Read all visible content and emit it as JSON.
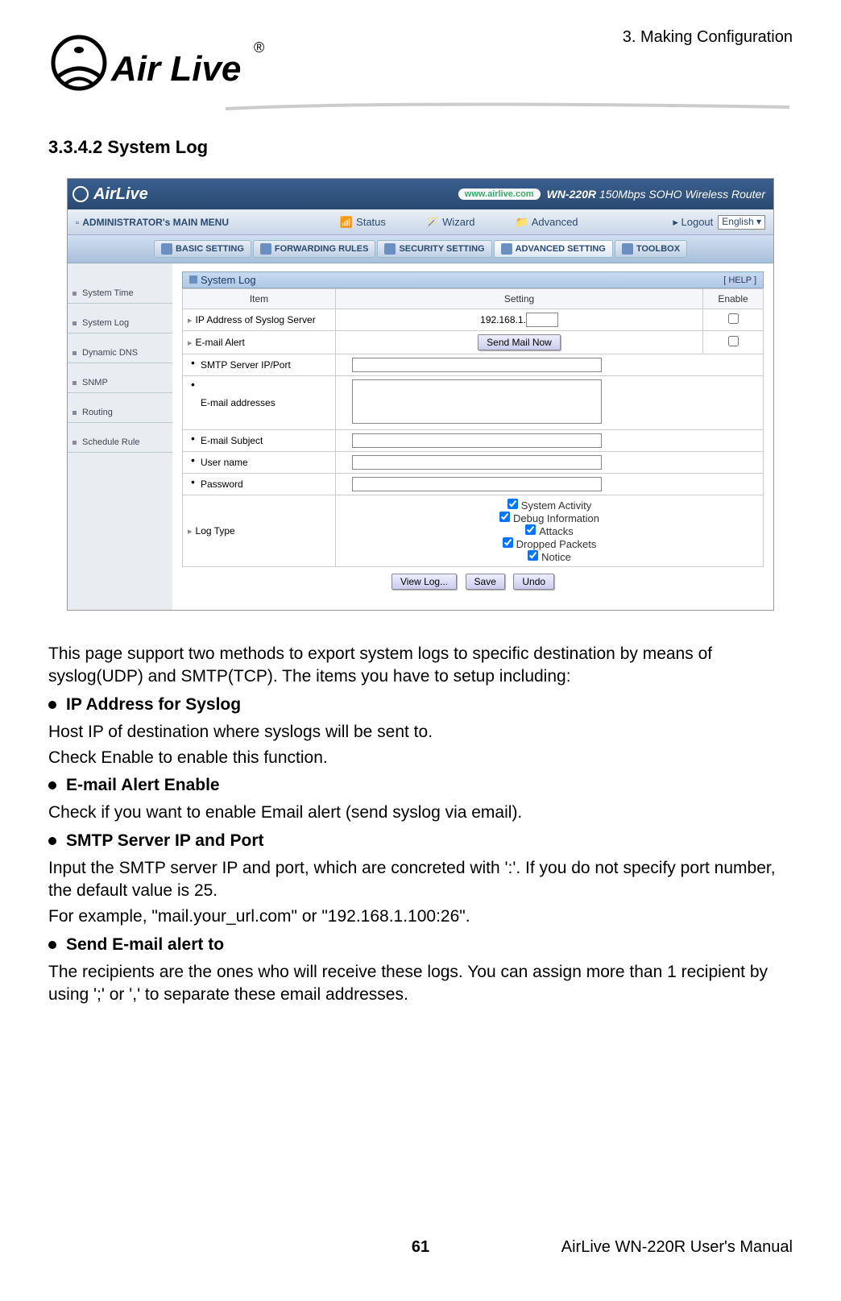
{
  "chapter": "3. Making Configuration",
  "logo_text": "Air Live",
  "section": "3.3.4.2  System Log",
  "screenshot": {
    "logo": "AirLive",
    "model_tag": "WN-220R",
    "model_desc": "150Mbps SOHO Wireless Router",
    "url_pill": "www.airlive.com",
    "main_menu_title": "ADMINISTRATOR's MAIN MENU",
    "menu_items": [
      "Status",
      "Wizard",
      "Advanced"
    ],
    "logout": "Logout",
    "lang": "English",
    "tabs": [
      "BASIC SETTING",
      "FORWARDING RULES",
      "SECURITY SETTING",
      "ADVANCED SETTING",
      "TOOLBOX"
    ],
    "active_tab_index": 3,
    "sidebar": [
      "System Time",
      "System Log",
      "Dynamic DNS",
      "SNMP",
      "Routing",
      "Schedule Rule"
    ],
    "panel_title": "System Log",
    "help_label": "[ HELP ]",
    "table_headers": {
      "item": "Item",
      "setting": "Setting",
      "enable": "Enable"
    },
    "rows": {
      "ip_syslog": "IP Address of Syslog Server",
      "ip_prefix": "192.168.1.",
      "email_alert": "E-mail Alert",
      "send_mail_btn": "Send Mail Now",
      "smtp": "SMTP Server IP/Port",
      "emails": "E-mail addresses",
      "subject": "E-mail Subject",
      "username": "User name",
      "password": "Password",
      "logtype": "Log Type"
    },
    "logtypes": [
      "System Activity",
      "Debug Information",
      "Attacks",
      "Dropped Packets",
      "Notice"
    ],
    "buttons": {
      "view": "View Log...",
      "save": "Save",
      "undo": "Undo"
    }
  },
  "content": {
    "intro": "This page support two methods to export system logs to specific destination by means of syslog(UDP) and SMTP(TCP). The items you have to setup including:",
    "b1": "IP Address for Syslog",
    "p1a": "Host IP of destination where syslogs will be sent to.",
    "p1b": "Check Enable to enable this function.",
    "b2": "E-mail Alert Enable",
    "p2": "Check if you want to enable Email alert (send syslog via email).",
    "b3": "SMTP Server IP and Port",
    "p3a": "Input the SMTP server IP and port, which are concreted with ':'. If you do not specify port number, the default value is 25.",
    "p3b": "For example, \"mail.your_url.com\" or \"192.168.1.100:26\".",
    "b4": "Send E-mail alert to",
    "p4": "The recipients are the ones who will receive these logs. You can assign more than 1 recipient by using ';' or ',' to separate these email addresses."
  },
  "footer": {
    "page": "61",
    "manual": "AirLive WN-220R User's Manual"
  }
}
